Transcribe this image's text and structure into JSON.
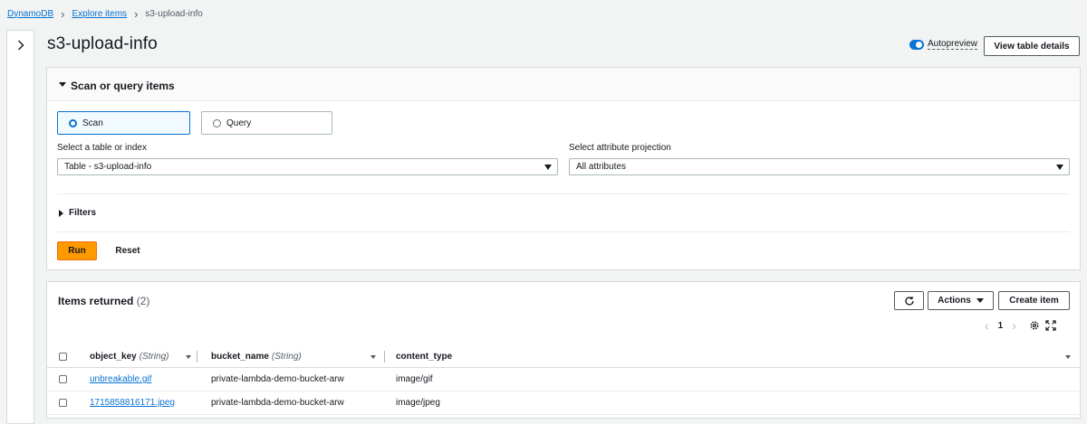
{
  "breadcrumb": {
    "items": [
      "DynamoDB",
      "Explore items"
    ],
    "current": "s3-upload-info"
  },
  "header": {
    "title": "s3-upload-info",
    "autopreview_label": "Autopreview",
    "autopreview_on": true,
    "view_details_label": "View table details"
  },
  "scan_panel": {
    "title": "Scan or query items",
    "modes": [
      {
        "label": "Scan",
        "selected": true
      },
      {
        "label": "Query",
        "selected": false
      }
    ],
    "table_label": "Select a table or index",
    "table_value": "Table - s3-upload-info",
    "projection_label": "Select attribute projection",
    "projection_value": "All attributes",
    "filters_label": "Filters",
    "run_label": "Run",
    "reset_label": "Reset"
  },
  "results": {
    "title": "Items returned",
    "count": "(2)",
    "actions_label": "Actions",
    "create_label": "Create item",
    "page": "1",
    "columns": [
      {
        "name": "object_key",
        "type": "(String)"
      },
      {
        "name": "bucket_name",
        "type": "(String)"
      },
      {
        "name": "content_type",
        "type": ""
      }
    ],
    "rows": [
      {
        "object_key": "unbreakable.gif",
        "bucket_name": "private-lambda-demo-bucket-arw",
        "content_type": "image/gif"
      },
      {
        "object_key": "1715858816171.jpeg",
        "bucket_name": "private-lambda-demo-bucket-arw",
        "content_type": "image/jpeg"
      }
    ]
  },
  "colors": {
    "link": "#0972d3",
    "primary_button": "#ff9900",
    "background": "#f2f3f3"
  },
  "icons": [
    "chevron-right-icon",
    "caret-down-icon",
    "caret-right-icon",
    "refresh-icon",
    "settings-icon",
    "fullscreen-icon"
  ]
}
